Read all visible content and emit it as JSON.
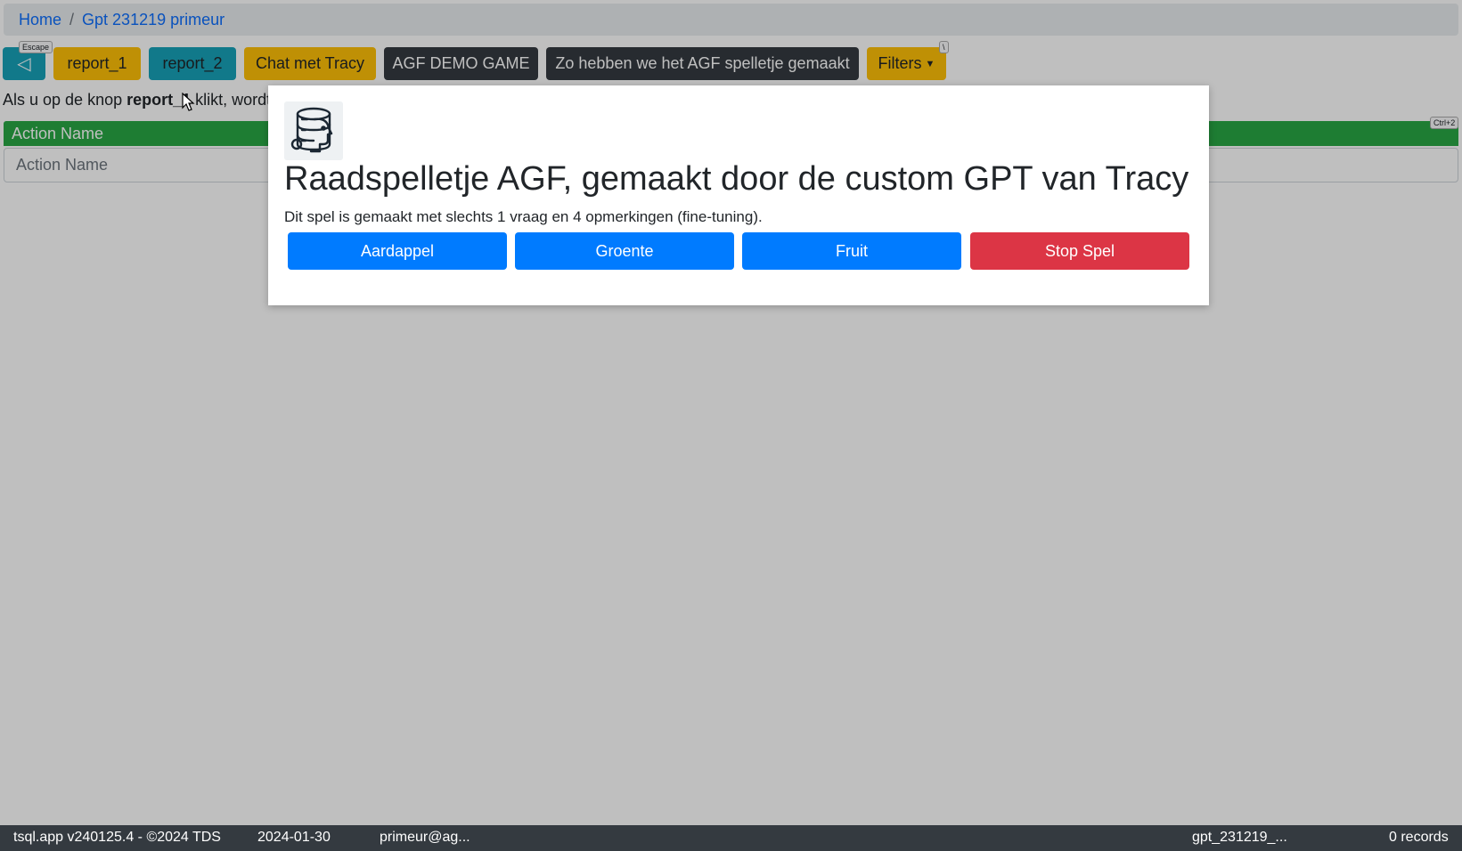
{
  "breadcrumb": {
    "home": "Home",
    "separator": "/",
    "current": "Gpt 231219 primeur"
  },
  "toolbar": {
    "back_icon": "◁",
    "back_shortcut": "Escape",
    "report1": "report_1",
    "report2": "report_2",
    "chat": "Chat met Tracy",
    "demo": "AGF DEMO GAME",
    "howto": "Zo hebben we het AGF spelletje gemaakt",
    "filters": "Filters",
    "filters_shortcut": "\\",
    "ctrl_shortcut": "Ctrl+2"
  },
  "info": {
    "prefix": "Als u op de knop ",
    "bold": "report_1",
    "suffix": " klikt, wordt"
  },
  "table": {
    "header": "Action Name",
    "filter_placeholder": "Action Name"
  },
  "modal": {
    "title": "Raadspelletje AGF, gemaakt door de custom GPT van Tracy",
    "description": "Dit spel is gemaakt met slechts 1 vraag en 4 opmerkingen (fine-tuning).",
    "buttons": {
      "b1": "Aardappel",
      "b2": "Groente",
      "b3": "Fruit",
      "b4": "Stop Spel"
    }
  },
  "footer": {
    "version": "tsql.app v240125.4 - ©2024 TDS",
    "date": "2024-01-30",
    "user": "primeur@ag...",
    "app": "gpt_231219_...",
    "records": "0 records"
  },
  "colors": {
    "primary": "#007bff",
    "danger": "#dc3545",
    "success": "#28a745",
    "warning": "#ffc107",
    "info": "#17a2b8",
    "dark": "#343a40"
  }
}
